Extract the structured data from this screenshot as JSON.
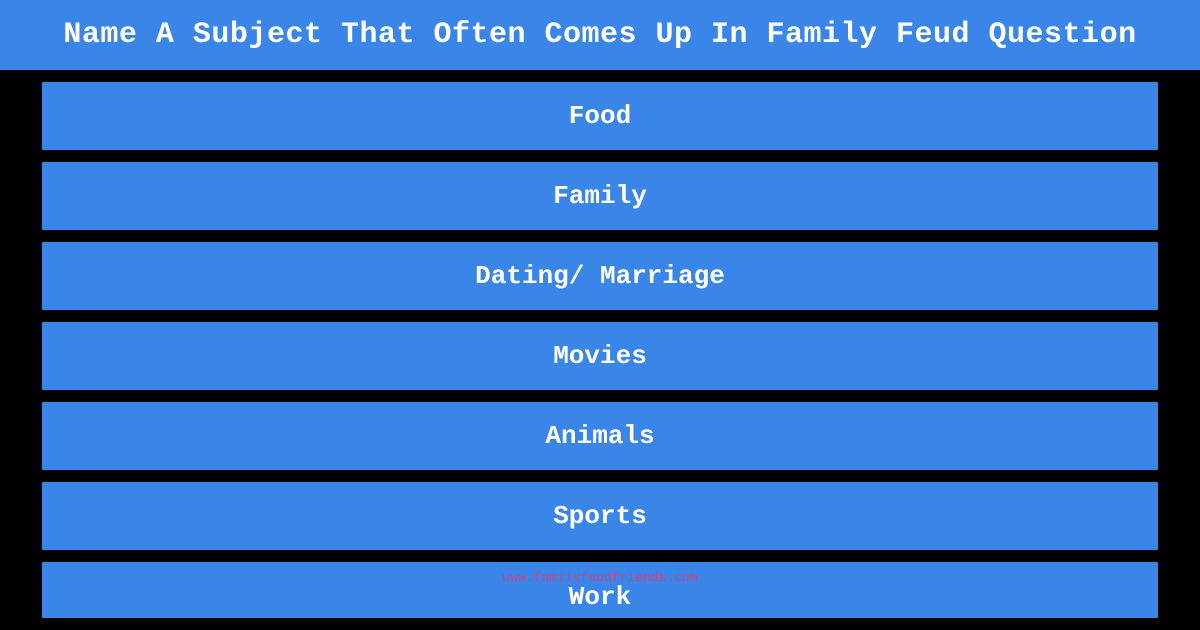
{
  "header": {
    "title": "Name A Subject That Often Comes Up In Family Feud Question",
    "bg_color": "#3a86e8"
  },
  "answers": [
    {
      "label": "Food"
    },
    {
      "label": "Family"
    },
    {
      "label": "Dating/ Marriage"
    },
    {
      "label": "Movies"
    },
    {
      "label": "Animals"
    },
    {
      "label": "Sports"
    },
    {
      "label": "Work"
    }
  ],
  "watermark": {
    "url_text": "www.familyfeudfriends.com"
  },
  "colors": {
    "bar_bg": "#3a86e8",
    "bar_text": "#ffffff",
    "page_bg": "#000000",
    "header_bg": "#3a86e8",
    "header_text": "#ffffff",
    "watermark_text": "#cc4488"
  }
}
